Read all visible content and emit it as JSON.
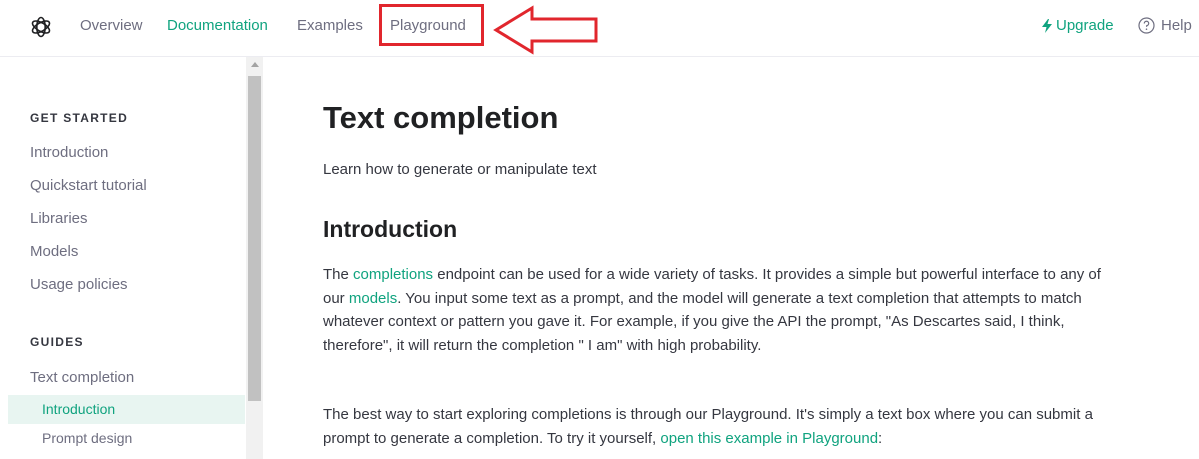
{
  "nav": {
    "links": [
      "Overview",
      "Documentation",
      "Examples",
      "Playground"
    ],
    "upgrade": "Upgrade",
    "help": "Help"
  },
  "sidebar": {
    "sections": [
      {
        "heading": "GET STARTED",
        "items": [
          "Introduction",
          "Quickstart tutorial",
          "Libraries",
          "Models",
          "Usage policies"
        ]
      },
      {
        "heading": "GUIDES",
        "items": [
          "Text completion"
        ],
        "subitems": [
          "Introduction",
          "Prompt design"
        ],
        "active_subitem": "Introduction"
      }
    ]
  },
  "main": {
    "title": "Text completion",
    "subtitle": "Learn how to generate or manipulate text",
    "section_heading": "Introduction",
    "p1": {
      "a": "The ",
      "link1": "completions",
      "b": " endpoint can be used for a wide variety of tasks. It provides a simple but powerful interface to any of our ",
      "link2": "models",
      "c": ". You input some text as a prompt, and the model will generate a text completion that attempts to match whatever context or pattern you gave it. For example, if you give the API the prompt, \"As Descartes said, I think, therefore\", it will return the completion \" I am\" with high probability."
    },
    "p2": {
      "a": "The best way to start exploring completions is through our Playground. It's simply a text box where you can submit a prompt to generate a completion. To try it yourself, ",
      "link": "open this example in Playground",
      "b": ":"
    }
  },
  "colors": {
    "accent": "#10a37f",
    "annotation": "#e1262d",
    "text": "#353740",
    "muted": "#6e6e80"
  },
  "icons": [
    "openai-logo-icon",
    "bolt-icon",
    "help-circle-icon",
    "scroll-up-arrow-icon",
    "annotation-arrow-icon"
  ]
}
